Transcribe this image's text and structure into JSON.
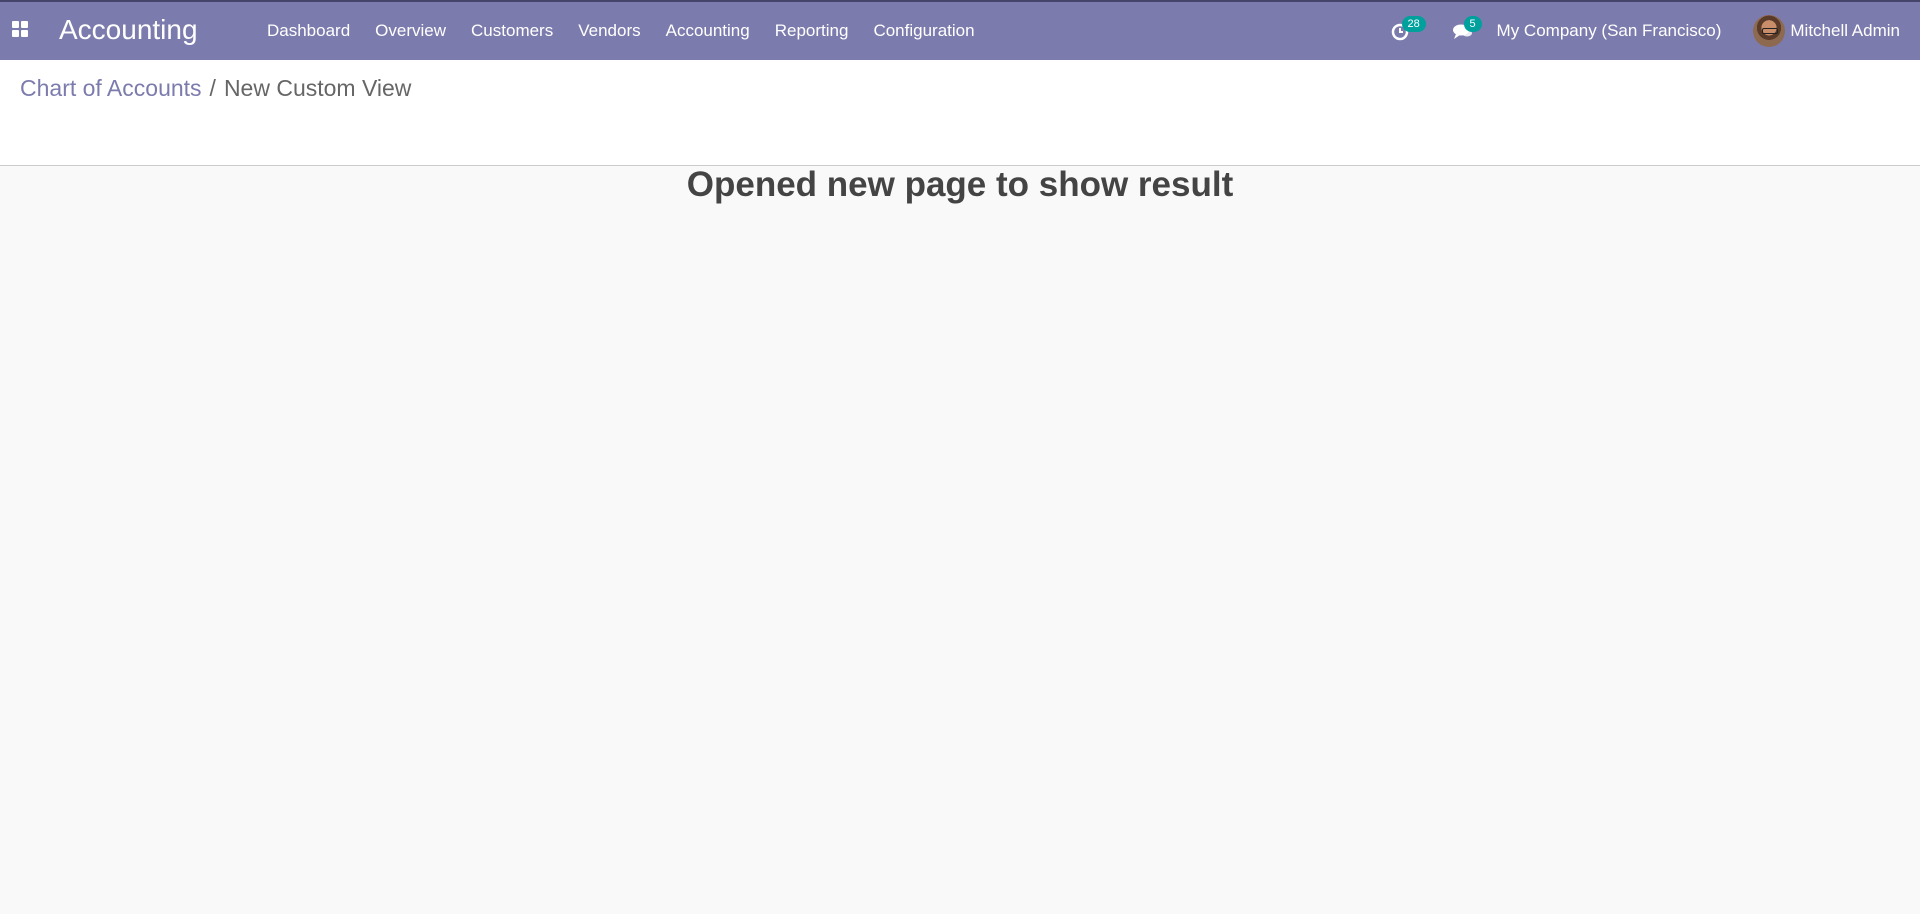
{
  "navbar": {
    "app_name": "Accounting",
    "background_color": "#7c7bad",
    "apps_icon": "apps-grid-icon",
    "menu": [
      {
        "label": "Dashboard"
      },
      {
        "label": "Overview"
      },
      {
        "label": "Customers"
      },
      {
        "label": "Vendors"
      },
      {
        "label": "Accounting"
      },
      {
        "label": "Reporting"
      },
      {
        "label": "Configuration"
      }
    ],
    "systray": {
      "activity": {
        "icon": "clock-icon",
        "count": "28"
      },
      "messages": {
        "icon": "chat-icon",
        "count": "5"
      },
      "company": "My Company (San Francisco)",
      "user_name": "Mitchell Admin"
    },
    "badge_color": "#00a09d"
  },
  "breadcrumb": {
    "parent": "Chart of Accounts",
    "separator": "/",
    "current": "New Custom View"
  },
  "main": {
    "message": "Opened new page to show result"
  }
}
